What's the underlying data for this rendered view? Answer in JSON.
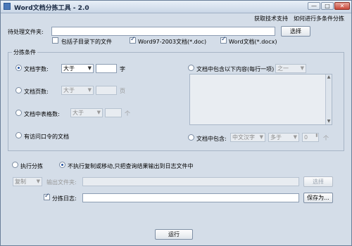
{
  "window": {
    "title": "Word文档分拣工具 - 2.0",
    "btn_min": "—",
    "btn_max": "□",
    "btn_close": "✕"
  },
  "menu": {
    "support": "获取技术支持",
    "multi_cond": "如何进行多条件分拣"
  },
  "source": {
    "label": "待处理文件夹:",
    "path": "",
    "browse": "选择",
    "include_sub": "包括子目录下的文件",
    "include_sub_checked": false,
    "doc_label": "Word97-2003文档(*.doc)",
    "doc_checked": true,
    "docx_label": "Word文档(*.docx)",
    "docx_checked": true
  },
  "conditions": {
    "group_title": "分拣条件",
    "char_count": {
      "label": "文档字数:",
      "operator": "大于",
      "value": "",
      "unit": "字",
      "selected": true
    },
    "page_count": {
      "label": "文档页数:",
      "operator": "大于",
      "value": "",
      "unit": "页",
      "selected": false
    },
    "table_count": {
      "label": "文档中表格数:",
      "operator": "大于",
      "value": "",
      "unit": "个",
      "selected": false
    },
    "password": {
      "label": "有访问口令的文档",
      "selected": false
    },
    "contains_any": {
      "label": "文档中包含以下内容(每行一项)",
      "mode": "之一",
      "lines": "",
      "selected": false
    },
    "contains_count": {
      "label": "文档中包含:",
      "char_type": "中文汉字",
      "operator": "多于",
      "value": "0",
      "unit": "个",
      "selected": false
    }
  },
  "action": {
    "execute": "执行分拣",
    "execute_selected": false,
    "log_only": "不执行复制或移动,只把查询结果输出到日志文件中",
    "log_only_selected": true,
    "copy_mode": "复制",
    "output_label": "输出文件夹:",
    "output_path": "",
    "output_browse": "选择",
    "log_label": "分拣日志:",
    "log_checked": true,
    "log_path": "",
    "save_as": "保存为..."
  },
  "run": "运行"
}
